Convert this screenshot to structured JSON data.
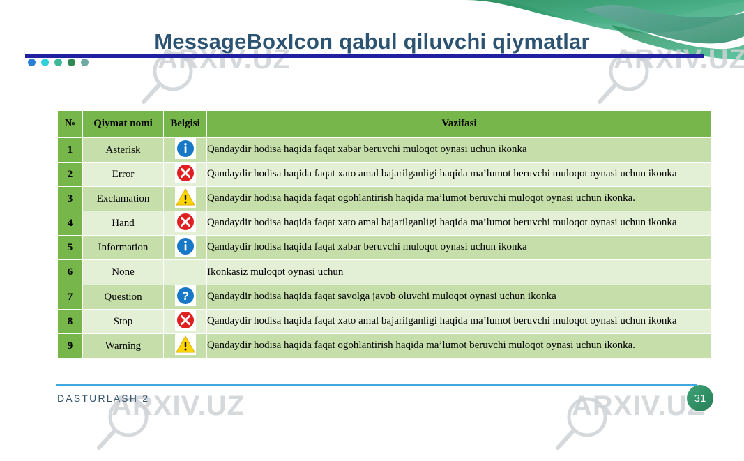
{
  "slide": {
    "title": "MessageBoxIcon qabul qiluvchi qiymatlar",
    "footer_label": "DASTURLASH 2",
    "page_number": "31",
    "watermark_text": "ARXIV.UZ"
  },
  "theme": {
    "title_color": "#2c5472",
    "title_rule_color": "#2020a0",
    "header_green": "#76b64b",
    "row_band_a": "#c6dfaa",
    "row_band_b": "#e3f0d6",
    "footer_rule_color": "#3fa9dd",
    "badge_green": "#2f8d63",
    "dot_colors": [
      "#2b7fd4",
      "#2fd0d8",
      "#3fb89a",
      "#2f8a52",
      "#6fa9a3"
    ]
  },
  "table": {
    "headers": {
      "no": "№",
      "name": "Qiymat nomi",
      "sign": "Belgisi",
      "task": "Vazifasi"
    },
    "rows": [
      {
        "no": "1",
        "name": "Asterisk",
        "icon": "info-circle-icon",
        "task": "Qandaydir hodisa haqida faqat xabar beruvchi muloqot oynasi uchun ikonka"
      },
      {
        "no": "2",
        "name": "Error",
        "icon": "error-circle-icon",
        "task": "Qandaydir hodisa haqida faqat xato amal bajarilganligi haqida ma’lumot beruvchi muloqot oynasi uchun ikonka"
      },
      {
        "no": "3",
        "name": "Exclamation",
        "icon": "warning-triangle-icon",
        "task": "Qandaydir hodisa haqida faqat ogohlantirish haqida ma’lumot beruvchi muloqot oynasi uchun ikonka."
      },
      {
        "no": "4",
        "name": "Hand",
        "icon": "error-circle-icon",
        "task": "Qandaydir hodisa haqida faqat xato amal bajarilganligi haqida ma’lumot beruvchi muloqot oynasi uchun ikonka"
      },
      {
        "no": "5",
        "name": "Information",
        "icon": "info-circle-icon",
        "task": "Qandaydir hodisa haqida faqat xabar beruvchi muloqot oynasi uchun ikonka"
      },
      {
        "no": "6",
        "name": "None",
        "icon": "none-icon",
        "task": "Ikonkasiz muloqot oynasi uchun"
      },
      {
        "no": "7",
        "name": "Question",
        "icon": "question-circle-icon",
        "task": "Qandaydir hodisa haqida faqat savolga javob oluvchi muloqot oynasi uchun ikonka"
      },
      {
        "no": "8",
        "name": "Stop",
        "icon": "error-circle-icon",
        "task": "Qandaydir hodisa haqida faqat xato amal bajarilganligi haqida ma’lumot beruvchi muloqot oynasi uchun ikonka"
      },
      {
        "no": "9",
        "name": "Warning",
        "icon": "warning-triangle-icon",
        "task": "Qandaydir hodisa haqida faqat ogohlantirish haqida ma’lumot beruvchi muloqot oynasi uchun ikonka."
      }
    ]
  }
}
